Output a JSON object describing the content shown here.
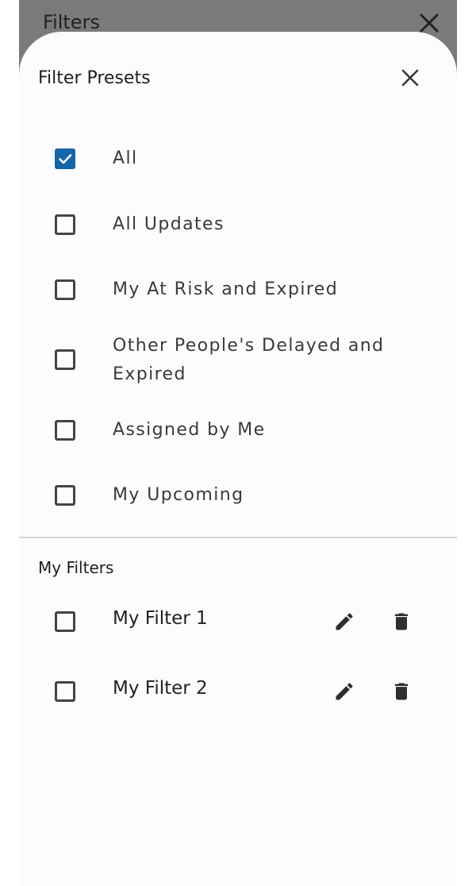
{
  "background_screen": {
    "title": "Filters"
  },
  "sheet": {
    "title": "Filter Presets",
    "presets": [
      {
        "label": "All",
        "checked": true
      },
      {
        "label": "All Updates",
        "checked": false
      },
      {
        "label": "My At Risk and Expired",
        "checked": false
      },
      {
        "label": "Other People's Delayed and Expired",
        "checked": false
      },
      {
        "label": "Assigned by Me",
        "checked": false
      },
      {
        "label": "My Upcoming",
        "checked": false
      }
    ],
    "my_filters_title": "My Filters",
    "my_filters": [
      {
        "label": "My Filter 1",
        "checked": false
      },
      {
        "label": "My Filter 2",
        "checked": false
      }
    ]
  },
  "icons": {
    "close": "close-icon",
    "check": "check-icon",
    "edit": "pencil-icon",
    "delete": "trash-icon"
  },
  "colors": {
    "accent": "#1466a6",
    "sheet_background": "#fcfcfe",
    "scrim": "#7a7a7a"
  }
}
